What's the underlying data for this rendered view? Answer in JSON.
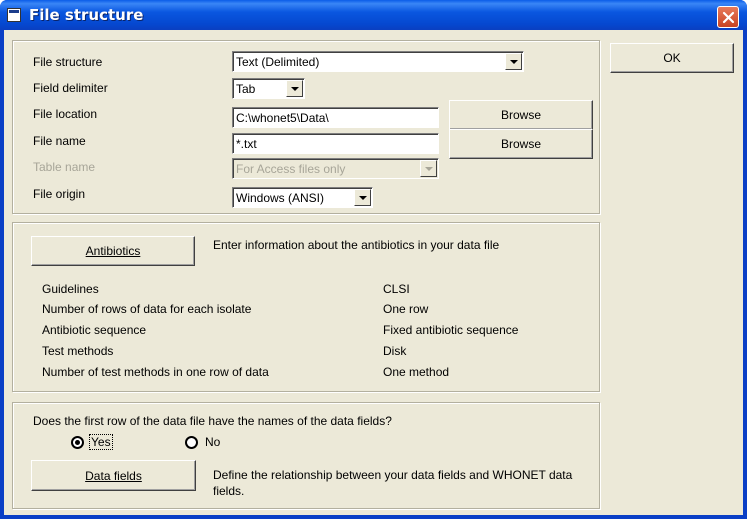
{
  "window": {
    "title": "File structure",
    "icon": "window-app-icon",
    "close_icon": "close-icon"
  },
  "ok_button": {
    "label": "OK"
  },
  "file_panel": {
    "file_structure": {
      "label": "File structure",
      "value": "Text (Delimited)"
    },
    "field_delimiter": {
      "label": "Field delimiter",
      "value": "Tab"
    },
    "file_location": {
      "label": "File location",
      "value": "C:\\whonet5\\Data\\",
      "browse": "Browse"
    },
    "file_name": {
      "label": "File name",
      "value": "*.txt",
      "browse": "Browse"
    },
    "table_name": {
      "label": "Table name",
      "value": "For Access files only"
    },
    "file_origin": {
      "label": "File origin",
      "value": "Windows (ANSI)"
    }
  },
  "antibiotics_panel": {
    "button": "Antibiotics",
    "description": "Enter information about the antibiotics in your data file",
    "rows": [
      {
        "label": "Guidelines",
        "value": "CLSI"
      },
      {
        "label": "Number of rows of data for each isolate",
        "value": "One row"
      },
      {
        "label": "Antibiotic sequence",
        "value": "Fixed antibiotic sequence"
      },
      {
        "label": "Test methods",
        "value": "Disk"
      },
      {
        "label": "Number of test methods in one row of data",
        "value": "One method"
      }
    ]
  },
  "fields_panel": {
    "question": "Does the first row of the data file have the names of the data fields?",
    "yes_label": "Yes",
    "no_label": "No",
    "selected": "Yes",
    "button": "Data fields",
    "description": "Define the relationship between your data fields and WHONET data fields."
  }
}
